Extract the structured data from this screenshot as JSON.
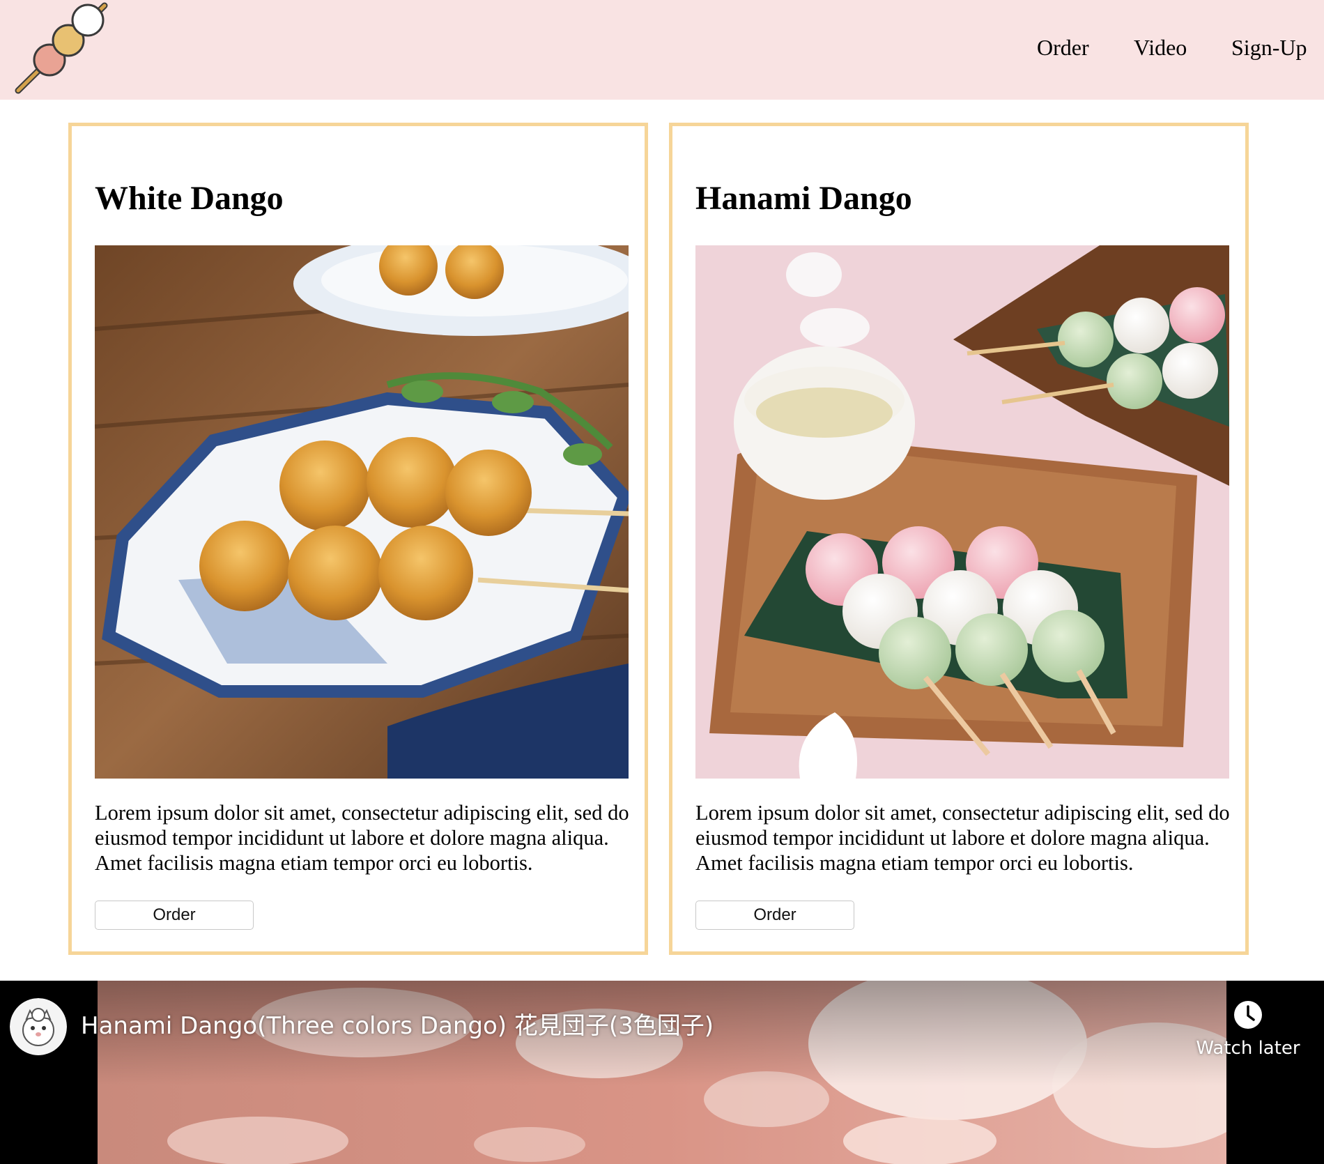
{
  "nav": {
    "links": [
      "Order",
      "Video",
      "Sign-Up"
    ]
  },
  "cards": [
    {
      "title": "White Dango",
      "description": "Lorem ipsum dolor sit amet, consectetur adipiscing elit, sed do eiusmod tempor incididunt ut labore et dolore magna aliqua. Amet facilisis magna etiam tempor orci eu lobortis.",
      "button_label": "Order"
    },
    {
      "title": "Hanami Dango",
      "description": "Lorem ipsum dolor sit amet, consectetur adipiscing elit, sed do eiusmod tempor incididunt ut labore et dolore magna aliqua. Amet facilisis magna etiam tempor orci eu lobortis.",
      "button_label": "Order"
    }
  ],
  "video": {
    "title": "Hanami Dango(Three colors Dango) 花見団子(3色団子)",
    "watch_later_label": "Watch later",
    "watch_later_icon": "clock-icon",
    "channel_icon": "channel-avatar-icon"
  },
  "colors": {
    "header_bg": "#f9e3e3",
    "card_border": "#f6d598",
    "video_bg": "#000000"
  }
}
